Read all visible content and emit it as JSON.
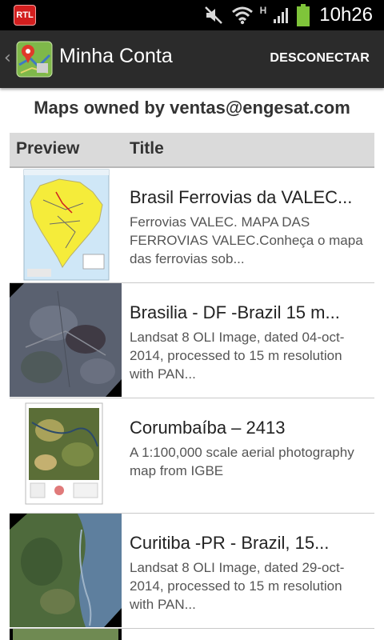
{
  "status_bar": {
    "left_badge": "RTL",
    "network_label": "H",
    "time": "10h26",
    "icons": [
      "rtl-app-icon",
      "mute-icon",
      "wifi-icon",
      "signal-icon",
      "battery-icon"
    ]
  },
  "action_bar": {
    "title": "Minha Conta",
    "action_label": "DESCONECTAR",
    "app_icon": "map-pin-icon",
    "background": "#2b2b2b"
  },
  "heading": "Maps owned by ventas@engesat.com",
  "table": {
    "columns": [
      "Preview",
      "Title"
    ],
    "header_bg": "#dadada",
    "rows": [
      {
        "title": "Brasil Ferrovias da VALEC...",
        "description": "Ferrovias VALEC. MAPA DAS FERROVIAS VALEC.Conheça o mapa das ferrovias sob...",
        "thumbnail": "brazil-railway-map-thumbnail"
      },
      {
        "title": "Brasilia - DF -Brazil 15 m...",
        "description": "Landsat 8 OLI Image, dated 04-oct-2014, processed to 15 m resolution with PAN...",
        "thumbnail": "satellite-image-thumbnail"
      },
      {
        "title": "Corumbaíba – 2413",
        "description": "A 1:100,000 scale aerial photography map from IGBE",
        "thumbnail": "aerial-map-thumbnail"
      },
      {
        "title": "Curitiba -PR - Brazil, 15...",
        "description": "Landsat 8 OLI Image, dated 29-oct-2014, processed to 15 m resolution with PAN...",
        "thumbnail": "satellite-image-thumbnail"
      }
    ]
  }
}
